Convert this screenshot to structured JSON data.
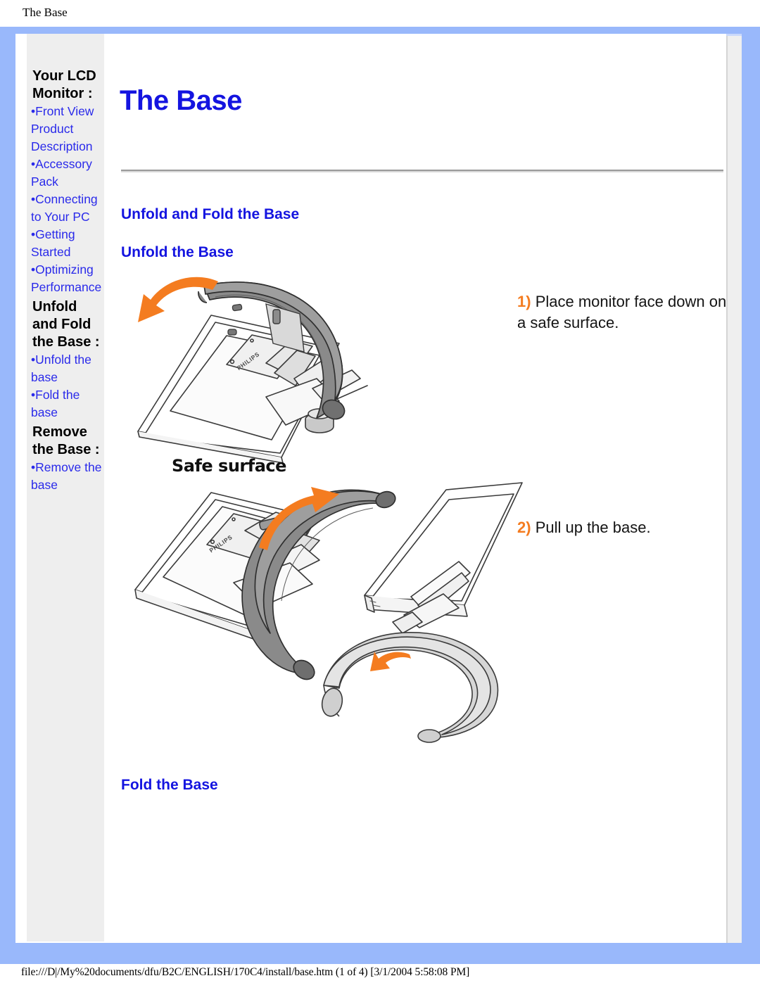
{
  "print": {
    "header_title": "The Base",
    "footer_path": "file:///D|/My%20documents/dfu/B2C/ENGLISH/170C4/install/base.htm (1 of 4) [3/1/2004 5:58:08 PM]"
  },
  "colors": {
    "frame_blue": "#99b8fb",
    "sidebar_bg": "#eeeeee",
    "link_blue": "#2a2aea",
    "heading_blue": "#1414e0",
    "step_orange": "#f47c20",
    "body_text": "#141414"
  },
  "sidebar": {
    "groups": [
      {
        "title": "Your LCD Monitor :",
        "title_lines": [
          "Your LCD",
          "Monitor :"
        ],
        "links": [
          {
            "label": "Front View Product Description",
            "lines": [
              "•Front View",
              "Product",
              "Description"
            ]
          },
          {
            "label": "Accessory Pack",
            "lines": [
              "•Accessory",
              "Pack"
            ]
          },
          {
            "label": "Connecting to Your PC",
            "lines": [
              "•Connecting",
              "to Your PC"
            ]
          },
          {
            "label": "Getting Started",
            "lines": [
              "•Getting",
              "Started"
            ]
          },
          {
            "label": "Optimizing Performance",
            "lines": [
              "•Optimizing",
              "Performance"
            ]
          }
        ]
      },
      {
        "title": "Unfold and Fold the Base :",
        "title_lines": [
          "Unfold",
          "and Fold",
          "the Base :"
        ],
        "links": [
          {
            "label": "Unfold the base",
            "lines": [
              "•Unfold the",
              "base"
            ]
          },
          {
            "label": "Fold the base",
            "lines": [
              "•Fold the",
              "base"
            ]
          }
        ]
      },
      {
        "title": "Remove the Base :",
        "title_lines": [
          "Remove",
          "the Base :"
        ],
        "links": [
          {
            "label": "Remove the base",
            "lines": [
              "•Remove the",
              "base"
            ]
          }
        ]
      }
    ]
  },
  "main": {
    "page_title": "The Base",
    "headings": {
      "unfold_and_fold": "Unfold and Fold the Base",
      "unfold": "Unfold the Base",
      "fold": "Fold the Base"
    },
    "steps": [
      {
        "number": "1)",
        "text": "Place monitor face down on a safe surface."
      },
      {
        "number": "2)",
        "text": "Pull up the base."
      }
    ],
    "figure_labels": {
      "safe_surface": "Safe surface"
    },
    "figures": [
      {
        "name": "monitor-face-down-unfold",
        "description": "Monitor lying face down on a safe surface with the curved dark-grey base arm folded against the rear panel; an orange curved arrow indicates rotating the base arm."
      },
      {
        "name": "pull-up-base",
        "description": "Left: monitor face down with the dark-grey curved base arm being rotated upward (orange arrow). Right: monitor standing upright on its light-grey curved base with an orange arrow at the hinge."
      }
    ]
  }
}
